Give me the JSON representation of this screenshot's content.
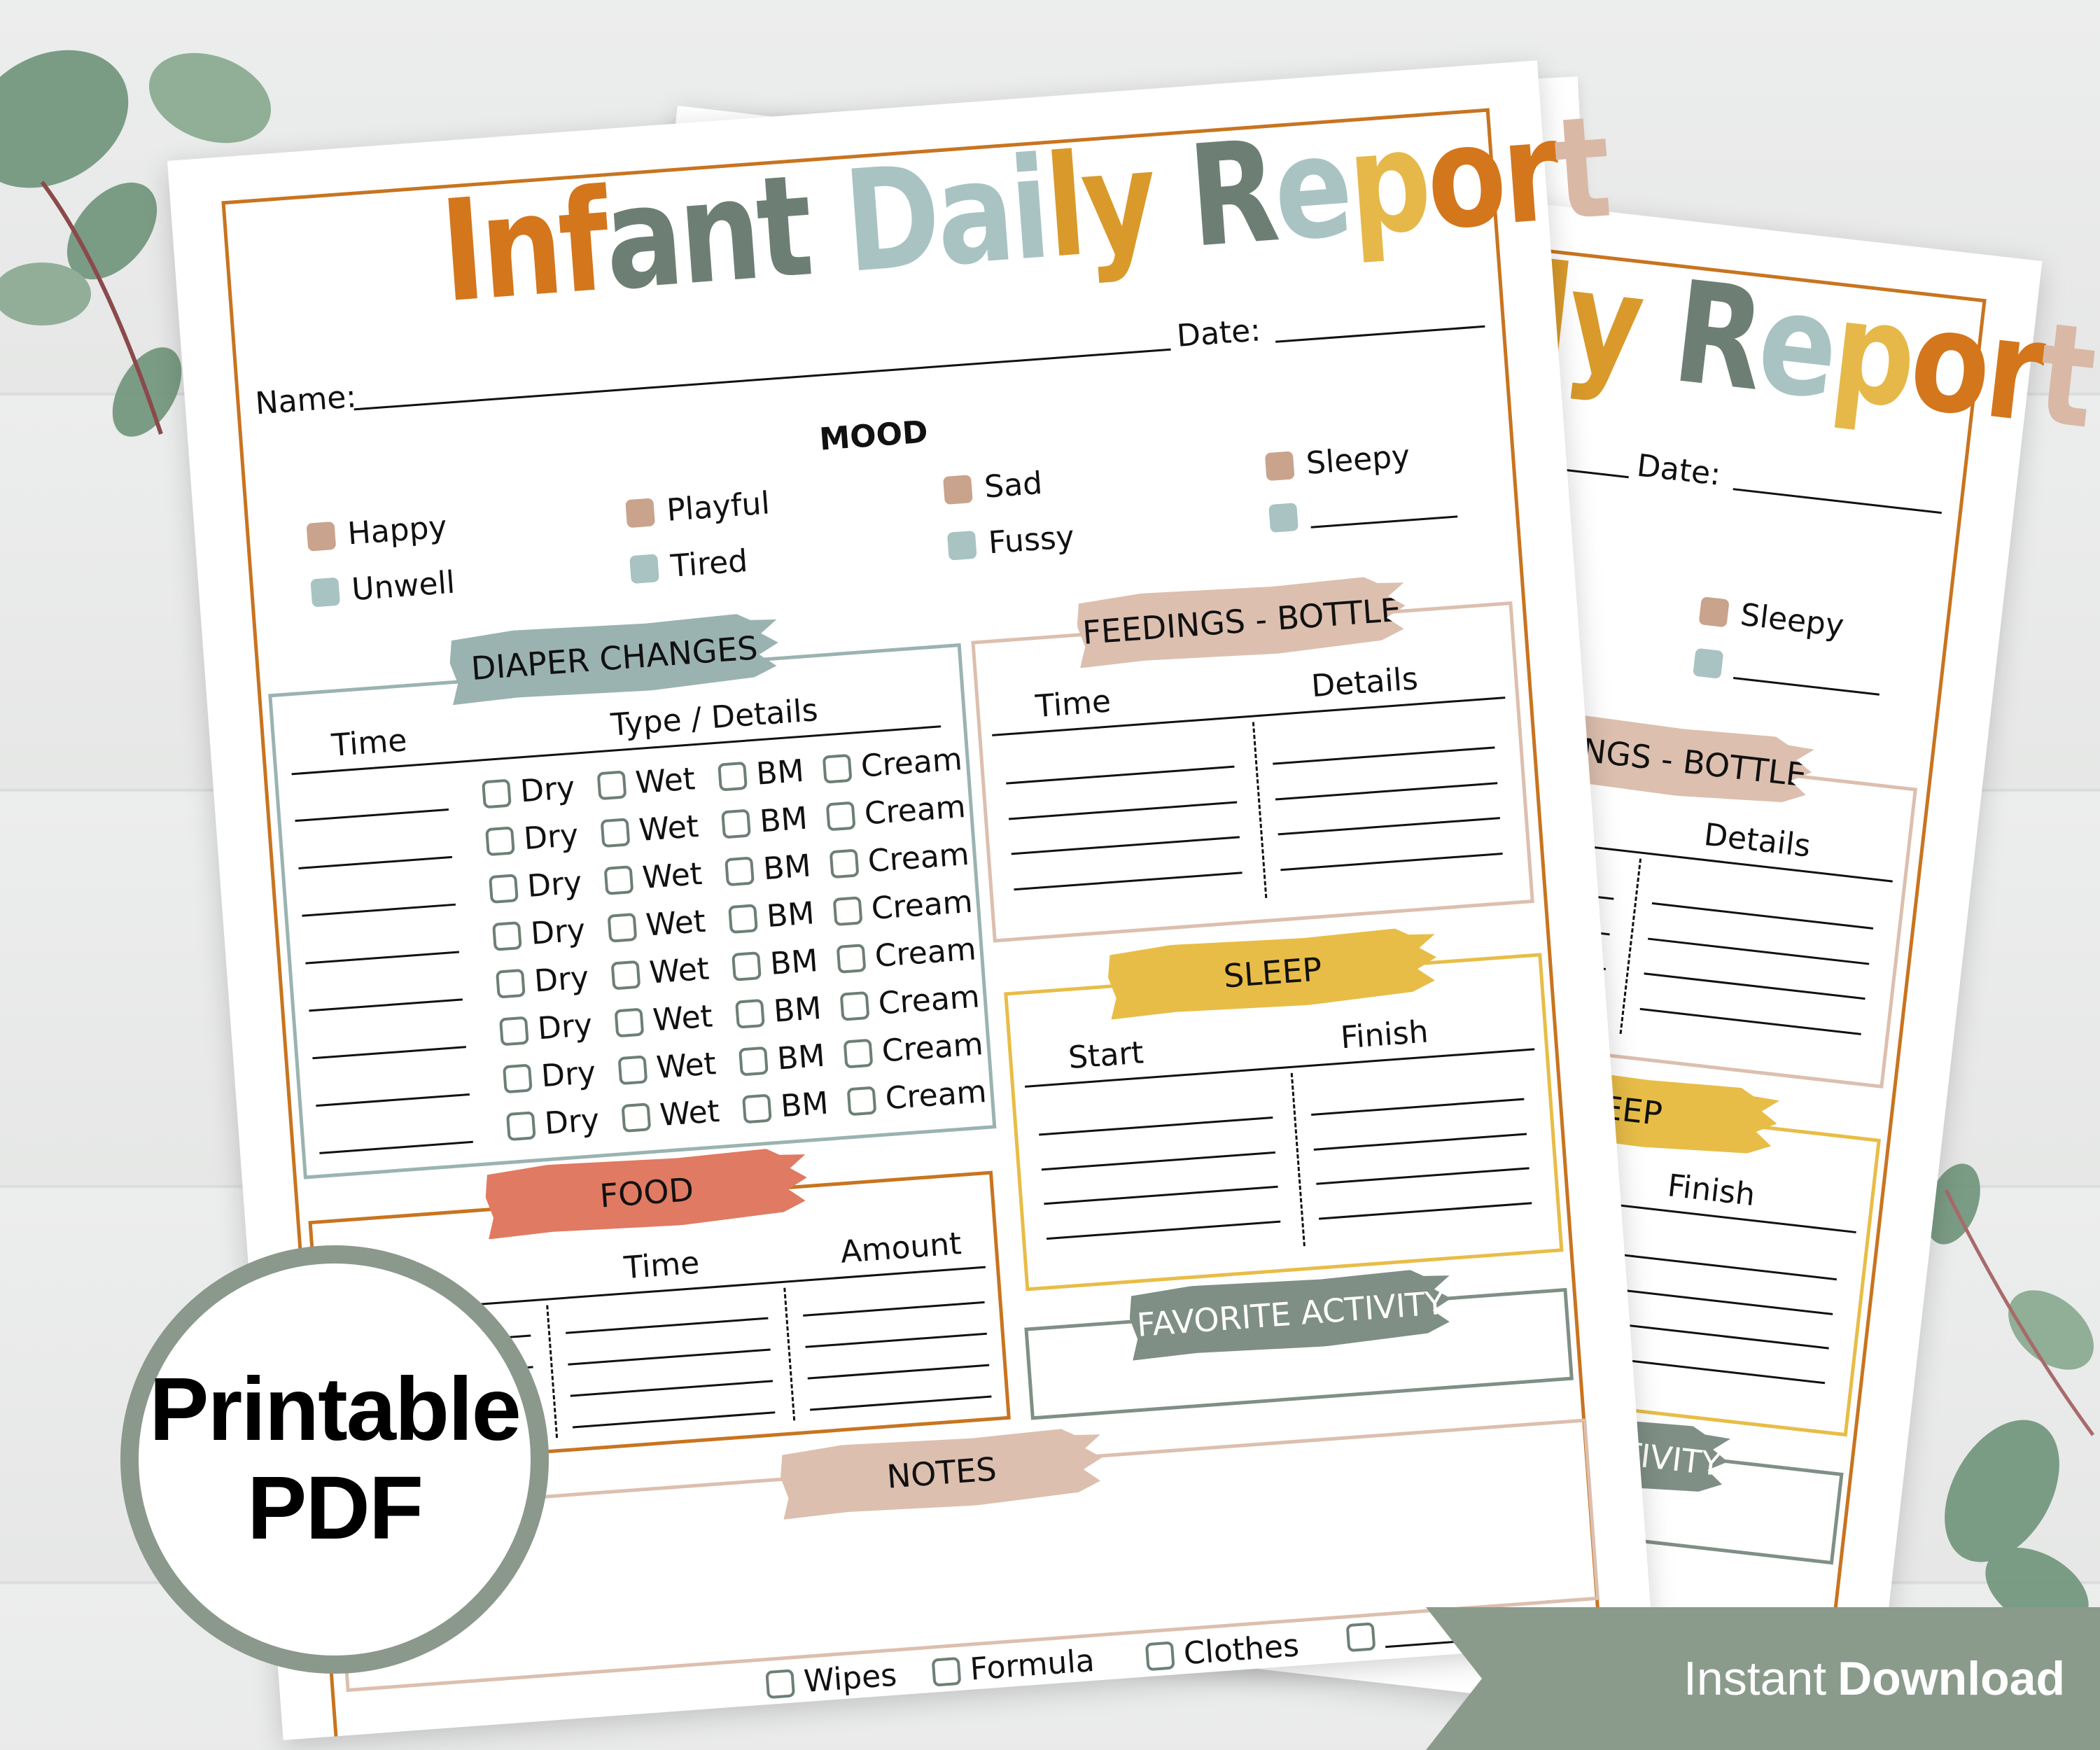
{
  "title": [
    {
      "text": "Inf",
      "color": "#d4761c"
    },
    {
      "text": "ant ",
      "color": "#6d7f74"
    },
    {
      "text": "Dai",
      "color": "#a9c3c3"
    },
    {
      "text": "ly ",
      "color": "#d99a2b"
    },
    {
      "text": "R",
      "color": "#6d7f74"
    },
    {
      "text": "e",
      "color": "#a9c3c3"
    },
    {
      "text": "p",
      "color": "#e6b84a"
    },
    {
      "text": "or",
      "color": "#d4761c"
    },
    {
      "text": "t",
      "color": "#d9b8a6"
    }
  ],
  "header": {
    "name_label": "Name:",
    "date_label": "Date:"
  },
  "mood": {
    "heading": "MOOD",
    "items": [
      {
        "label": "Happy",
        "color": "#c9a38c"
      },
      {
        "label": "Playful",
        "color": "#c9a38c"
      },
      {
        "label": "Sad",
        "color": "#c9a38c"
      },
      {
        "label": "Sleepy",
        "color": "#c9a38c"
      },
      {
        "label": "Unwell",
        "color": "#a9c3c3"
      },
      {
        "label": "Tired",
        "color": "#a9c3c3"
      },
      {
        "label": "Fussy",
        "color": "#a9c3c3"
      },
      {
        "label": "",
        "color": "#a9c3c3"
      }
    ]
  },
  "diaper": {
    "heading": "DIAPER CHANGES",
    "color": "#9ab3b1",
    "columns": [
      "Time",
      "Type / Details"
    ],
    "rows": [
      [
        "Dry",
        "Wet",
        "BM",
        "Cream"
      ],
      [
        "Dry",
        "Wet",
        "BM",
        "Cream"
      ],
      [
        "Dry",
        "Wet",
        "BM",
        "Cream"
      ],
      [
        "Dry",
        "Wet",
        "BM",
        "Cream"
      ],
      [
        "Dry",
        "Wet",
        "BM",
        "Cream"
      ],
      [
        "Dry",
        "Wet",
        "BM",
        "Cream"
      ],
      [
        "Dry",
        "Wet",
        "BM",
        "Cream"
      ],
      [
        "Dry",
        "Wet",
        "BM",
        "Cream"
      ]
    ]
  },
  "feedings": {
    "heading": "FEEDINGS - BOTTLE",
    "color": "#dcbfae",
    "columns": [
      "Time",
      "Details"
    ]
  },
  "sleep": {
    "heading": "SLEEP",
    "color": "#e8bd47",
    "columns": [
      "Start",
      "Finish"
    ]
  },
  "favorite": {
    "heading": "FAVORITE ACTIVITY",
    "color": "#7f8f85"
  },
  "food": {
    "heading": "FOOD",
    "color": "#e07a62",
    "border": "#c8741f",
    "columns": [
      "Type",
      "Time",
      "Amount"
    ]
  },
  "notes": {
    "heading": "NOTES",
    "color": "#dcbfae"
  },
  "supplies": [
    "Wipes",
    "Formula",
    "Clothes",
    ""
  ],
  "badge": {
    "line1": "Printable",
    "line2": "PDF"
  },
  "banner": {
    "light": "Instant",
    "bold": "Download"
  },
  "colors": {
    "frame": "#c8741f",
    "badge": "#8a998c",
    "banner": "#8a9b8b",
    "leaf": "#6f9479"
  }
}
